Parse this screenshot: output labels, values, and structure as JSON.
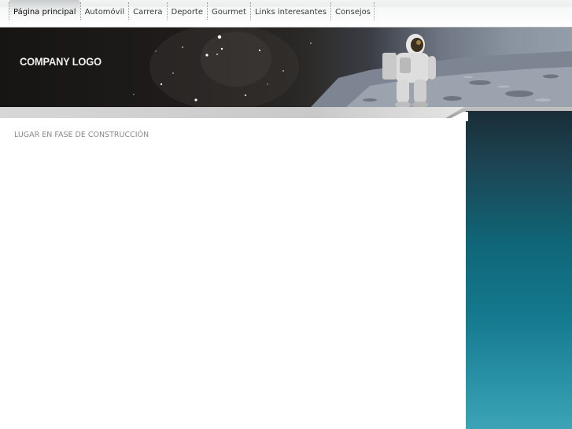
{
  "nav": {
    "items": [
      {
        "label": "Página principal",
        "active": true
      },
      {
        "label": "Automóvil",
        "active": false
      },
      {
        "label": "Carrera",
        "active": false
      },
      {
        "label": "Deporte",
        "active": false
      },
      {
        "label": "Gourmet",
        "active": false
      },
      {
        "label": "Links interesantes",
        "active": false
      },
      {
        "label": "Consejos",
        "active": false
      }
    ]
  },
  "header": {
    "logo_text": "COMPANY LOGO",
    "banner_image": "astronaut-on-moon"
  },
  "main": {
    "notice": "LUGAR EN FASE DE CONSTRUCCIÓN"
  },
  "colors": {
    "nav_text": "#3a3a3a",
    "banner_dark": "#1f1c1b",
    "notice_text": "#8a8a8a",
    "sidebar_top": "#1a2d37",
    "sidebar_bottom": "#3ca4b6"
  }
}
